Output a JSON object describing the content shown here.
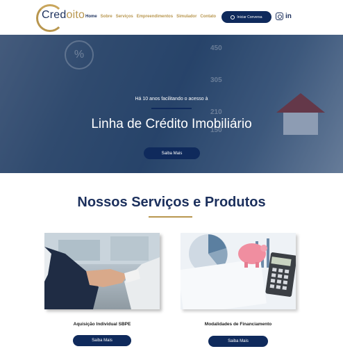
{
  "brand": {
    "logo_text_a": "Cred",
    "logo_text_b": "oito"
  },
  "nav": {
    "items": [
      "Home",
      "Sobre",
      "Serviços",
      "Empreendimentos",
      "Simulador",
      "Contato"
    ],
    "active": "Home"
  },
  "header": {
    "cta_label": "Iniciar Conversa"
  },
  "hero": {
    "subtitle": "Há 10 anos facilitando o acesso à",
    "title": "Linha de Crédito Imobiliário",
    "button_label": "Saiba Mais",
    "bg_numbers": [
      "450",
      "305",
      "210",
      "150"
    ],
    "percent_symbol": "%"
  },
  "services": {
    "title": "Nossos Serviços e Produtos",
    "cards": [
      {
        "label": "Aquisição Individual SBPE",
        "button_label": "Saiba Mais",
        "image": "handshake-photo"
      },
      {
        "label": "Modalidades de Financiamento",
        "button_label": "Saiba Mais",
        "image": "piggy-bank-calculator-photo"
      }
    ]
  },
  "colors": {
    "navy": "#0f2a5c",
    "gold": "#b8964e"
  }
}
